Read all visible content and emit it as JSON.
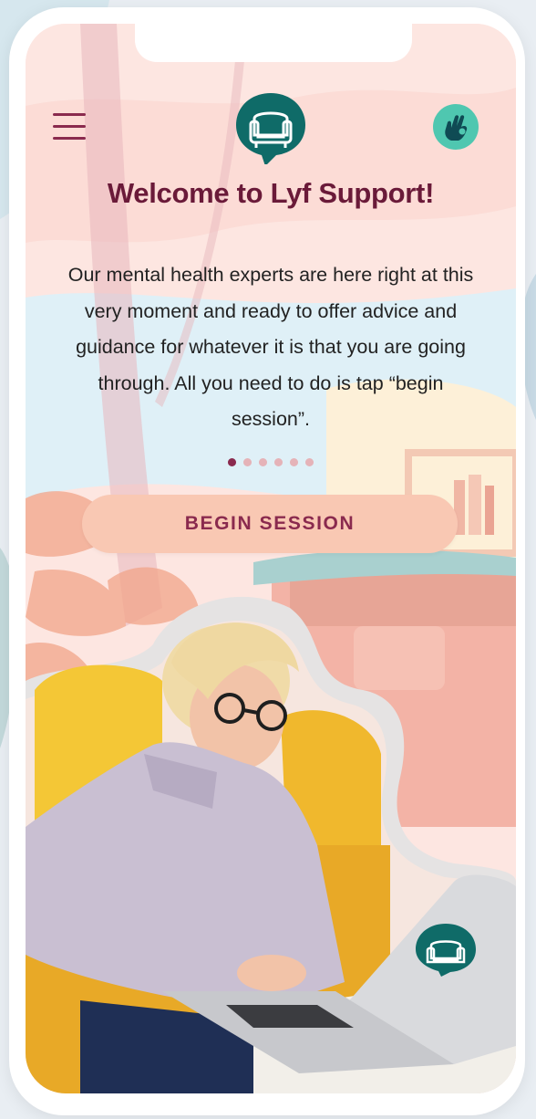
{
  "app": {
    "title": "Welcome to Lyf Support!",
    "description": "Our mental health experts are here right at this very moment and ready to offer advice and guidance for whatever it is that you are going through. All you need to do is tap “begin session”.",
    "cta_label": "BEGIN SESSION",
    "slides_total": 6,
    "slide_active": 1
  },
  "icons": {
    "menu": "menu-icon",
    "logo": "armchair-logo-icon",
    "gesture": "ok-hand-icon",
    "laptop_logo": "armchair-logo-icon"
  },
  "colors": {
    "brand_teal": "#0f6b68",
    "accent_mint": "#4fc7b0",
    "title_plum": "#6a1a39",
    "button_peach": "#f9c8b3",
    "button_text": "#8a2a4e"
  }
}
